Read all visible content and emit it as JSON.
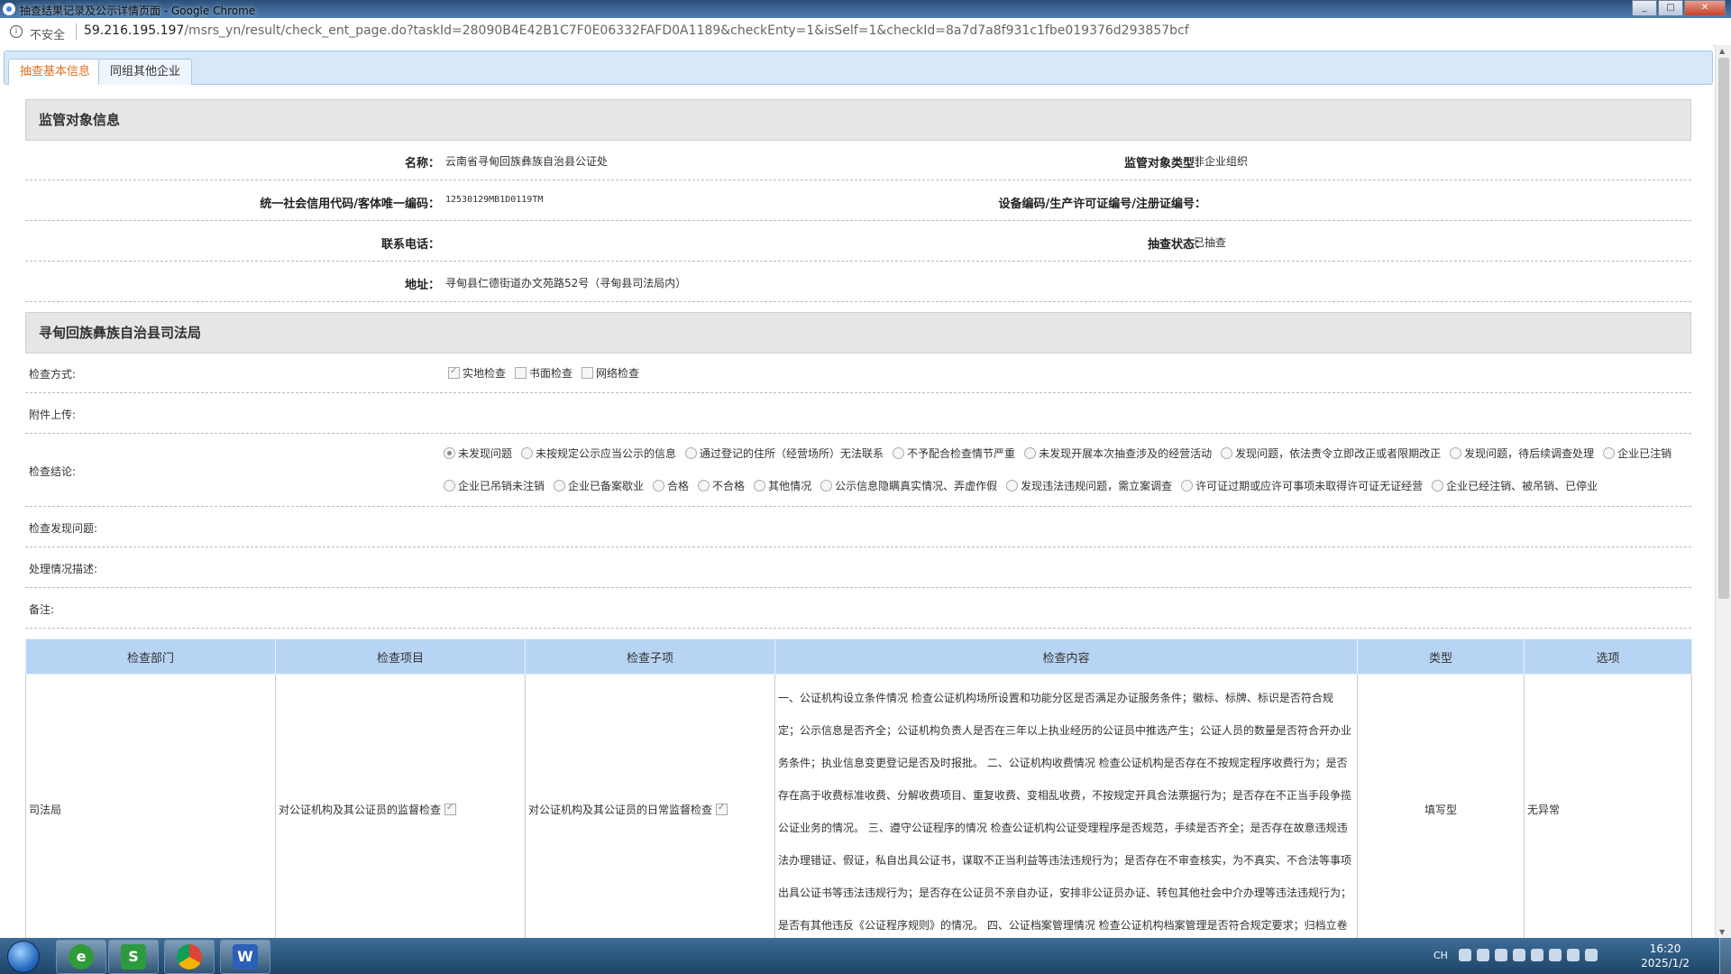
{
  "window": {
    "title": "抽查结果记录及公示详情页面 - Google Chrome",
    "min": "_",
    "max": "□",
    "close": "✕"
  },
  "address": {
    "insecure": "不安全",
    "host": "59.216.195.197",
    "path": "/msrs_yn/result/check_ent_page.do?taskId=28090B4E42B1C7F0E06332FAFD0A1189&checkEnty=1&isSelf=1&checkId=8a7d7a8f931c1fbe019376d293857bcf"
  },
  "tabs": [
    "抽查基本信息",
    "同组其他企业"
  ],
  "supervision": {
    "title": "监管对象信息",
    "name_label": "名称：",
    "name": "云南省寻甸回族彝族自治县公证处",
    "type_label": "监管对象类型：",
    "type": "非企业组织",
    "code_label": "统一社会信用代码/客体唯一编码：",
    "code": "12530129MB1D0119TM",
    "device_label": "设备编码/生产许可证编号/注册证编号：",
    "device": "",
    "phone_label": "联系电话：",
    "phone": "",
    "status_label": "抽查状态：",
    "status": "已抽查",
    "address_label": "地址：",
    "address": "寻甸县仁德街道办文苑路52号（寻甸县司法局内）"
  },
  "inspection": {
    "title": "寻甸回族彝族自治县司法局",
    "method_label": "检查方式:",
    "methods": [
      "实地检查",
      "书面检查",
      "网络检查"
    ],
    "method_checked": [
      true,
      false,
      false
    ],
    "attachment_label": "附件上传:",
    "conclusion_label": "检查结论:",
    "conclusions": [
      "未发现问题",
      "未按规定公示应当公示的信息",
      "通过登记的住所（经营场所）无法联系",
      "不予配合检查情节严重",
      "未发现开展本次抽查涉及的经营活动",
      "发现问题，依法责令立即改正或者限期改正",
      "发现问题，待后续调查处理",
      "企业已注销",
      "企业已吊销未注销",
      "企业已备案歇业",
      "合格",
      "不合格",
      "其他情况",
      "公示信息隐瞒真实情况、弄虚作假",
      "发现违法违规问题，需立案调查",
      "许可证过期或应许可事项未取得许可证无证经营",
      "企业已经注销、被吊销、已停业"
    ],
    "conclusion_selected": 0,
    "issues_label": "检查发现问题:",
    "handling_label": "处理情况描述:",
    "remarks_label": "备注:"
  },
  "table": {
    "headers": [
      "检查部门",
      "检查项目",
      "检查子项",
      "检查内容",
      "类型",
      "选项"
    ],
    "rows": [
      {
        "dept": "司法局",
        "item": "对公证机构及其公证员的监督检查",
        "subitem": "对公证机构及其公证员的日常监督检查",
        "content": "一、公证机构设立条件情况 检查公证机构场所设置和功能分区是否满足办证服务条件；徽标、标牌、标识是否符合规定；公示信息是否齐全；公证机构负责人是否在三年以上执业经历的公证员中推选产生；公证人员的数量是否符合开办业务条件；执业信息变更登记是否及时报批。 二、公证机构收费情况 检查公证机构是否存在不按规定程序收费行为；是否存在高于收费标准收费、分解收费项目、重复收费、变相乱收费，不按规定开具合法票据行为；是否存在不正当手段争揽公证业务的情况。 三、遵守公证程序的情况 检查公证机构公证受理程序是否规范，手续是否齐全；是否存在故意违规违法办理错证、假证，私自出具公证书，谋取不正当利益等违法违规行为；是否存在不审查核实，为不真实、不合法等事项出具公证书等违法违规行为；是否存在公证员不亲自办证，安排非公证员办证、转包其他社会中介办理等违法违规行为；是否有其他违反《公证程序规则》的情况。 四、公证档案管理情况 检查公证机构档案管理是否符合规定要求；归档立卷资料",
        "type": "填写型",
        "option": "无异常"
      }
    ]
  },
  "taskbar": {
    "lang": "CH",
    "time": "16:20",
    "date": "2025/1/2"
  }
}
